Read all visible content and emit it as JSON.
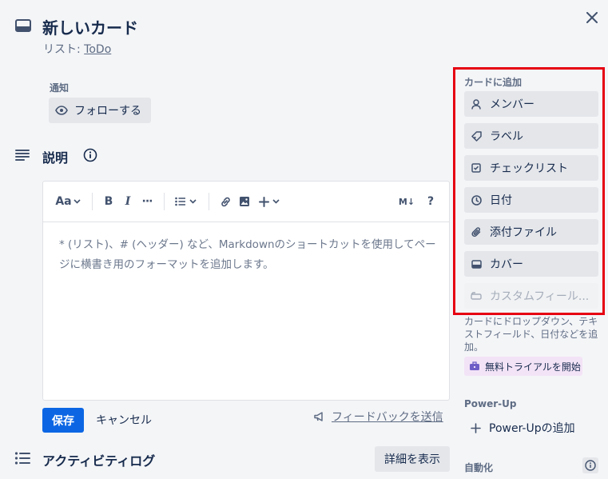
{
  "card": {
    "title": "新しいカード",
    "list_prefix": "リスト: ",
    "list_name": "ToDo"
  },
  "notifications": {
    "label": "通知",
    "follow_label": "フォローする"
  },
  "description": {
    "title": "説明",
    "toolbar": {
      "text_style": "Aa",
      "bold": "B",
      "italic": "I",
      "more": "···",
      "markdown": "M↓",
      "help": "?"
    },
    "placeholder": "* (リスト)、# (ヘッダー) など、Markdownのショートカットを使用してページに横書き用のフォーマットを追加します。",
    "save_label": "保存",
    "cancel_label": "キャンセル",
    "feedback_label": "フィードバックを送信"
  },
  "activity": {
    "title": "アクティビティログ",
    "details_label": "詳細を表示"
  },
  "sidebar": {
    "add_to_card_label": "カードに追加",
    "buttons": [
      {
        "label": "メンバー",
        "icon": "person-icon"
      },
      {
        "label": "ラベル",
        "icon": "tag-icon"
      },
      {
        "label": "チェックリスト",
        "icon": "checkbox-icon"
      },
      {
        "label": "日付",
        "icon": "clock-icon"
      },
      {
        "label": "添付ファイル",
        "icon": "paperclip-icon"
      },
      {
        "label": "カバー",
        "icon": "cover-icon"
      },
      {
        "label": "カスタムフィール...",
        "icon": "custom-field-icon"
      }
    ],
    "custom_field_desc": "カードにドロップダウン、テキストフィールド、日付などを追加。",
    "trial_label": "無料トライアルを開始",
    "powerup_label": "Power-Up",
    "powerup_add_label": "Power-Upの追加",
    "automation_label": "自動化"
  },
  "colors": {
    "highlight_border": "#e60012",
    "primary_button": "#0c66e4",
    "trial_background": "#f3e3f7"
  }
}
